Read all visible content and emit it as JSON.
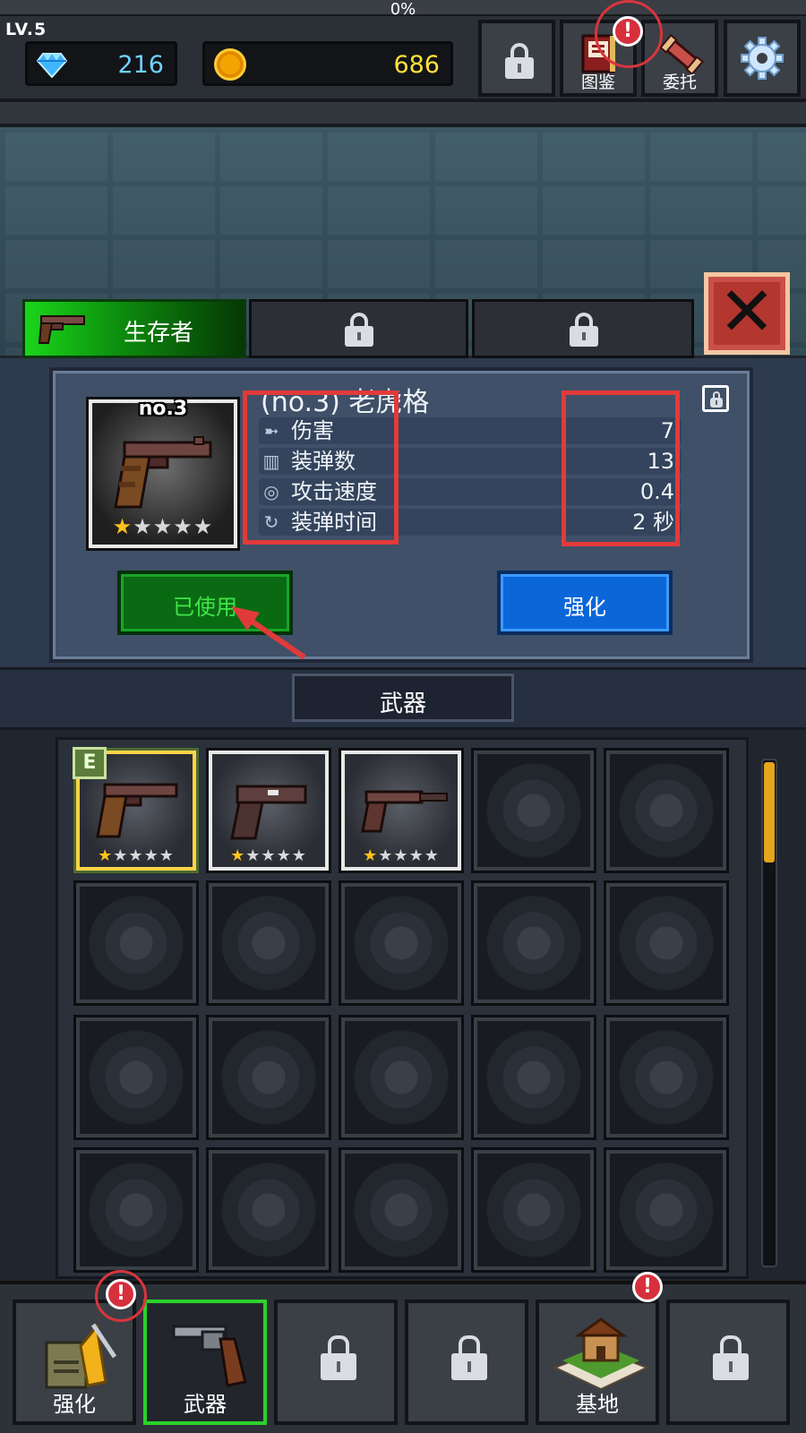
{
  "header": {
    "xp_percent_text": "0%",
    "level": "LV.5",
    "gems": "216",
    "gold": "686",
    "buttons": [
      {
        "label": "",
        "locked": true,
        "icon": "lock-icon"
      },
      {
        "label": "图鉴",
        "icon": "book-icon",
        "alert": true
      },
      {
        "label": "委托",
        "icon": "scroll-icon"
      },
      {
        "label": "",
        "icon": "gear-icon"
      }
    ],
    "alert_glyph": "!"
  },
  "tabs": [
    {
      "label": "生存者",
      "active": true,
      "icon": "pistol-icon"
    },
    {
      "label": "",
      "locked": true
    },
    {
      "label": "",
      "locked": true
    }
  ],
  "detail": {
    "card_number": "no.3",
    "weapon_title": "(no.3) 老虎格",
    "stars_filled": 1,
    "stars_total": 5,
    "stats": [
      {
        "icon": "bullet-icon",
        "name": "伤害",
        "value": "7"
      },
      {
        "icon": "magazine-icon",
        "name": "装弹数",
        "value": "13"
      },
      {
        "icon": "target-icon",
        "name": "攻击速度",
        "value": "0.4"
      },
      {
        "icon": "reload-icon",
        "name": "装弹时间",
        "value": "2 秒"
      }
    ],
    "equipped_label": "已使用",
    "upgrade_label": "强化"
  },
  "category": {
    "label": "武器"
  },
  "inventory": {
    "equipped_badge": "E",
    "items": [
      {
        "filled": true,
        "equipped": true,
        "stars": 1
      },
      {
        "filled": true,
        "stars": 1
      },
      {
        "filled": true,
        "stars": 1
      }
    ],
    "empty_slots": 17
  },
  "bottom_nav": [
    {
      "label": "强化",
      "icon": "upgrade-icon",
      "alert": true
    },
    {
      "label": "武器",
      "icon": "revolver-icon",
      "active": true
    },
    {
      "label": "",
      "locked": true
    },
    {
      "label": "",
      "locked": true
    },
    {
      "label": "基地",
      "icon": "base-icon",
      "alert": true
    },
    {
      "label": "",
      "locked": true
    }
  ],
  "colors": {
    "accent_green": "#1bd61b",
    "upgrade_blue": "#0b66d8",
    "annotation_red": "#e23a3a",
    "gold_text": "#ffe23a",
    "gem_text": "#6fd3ff"
  }
}
